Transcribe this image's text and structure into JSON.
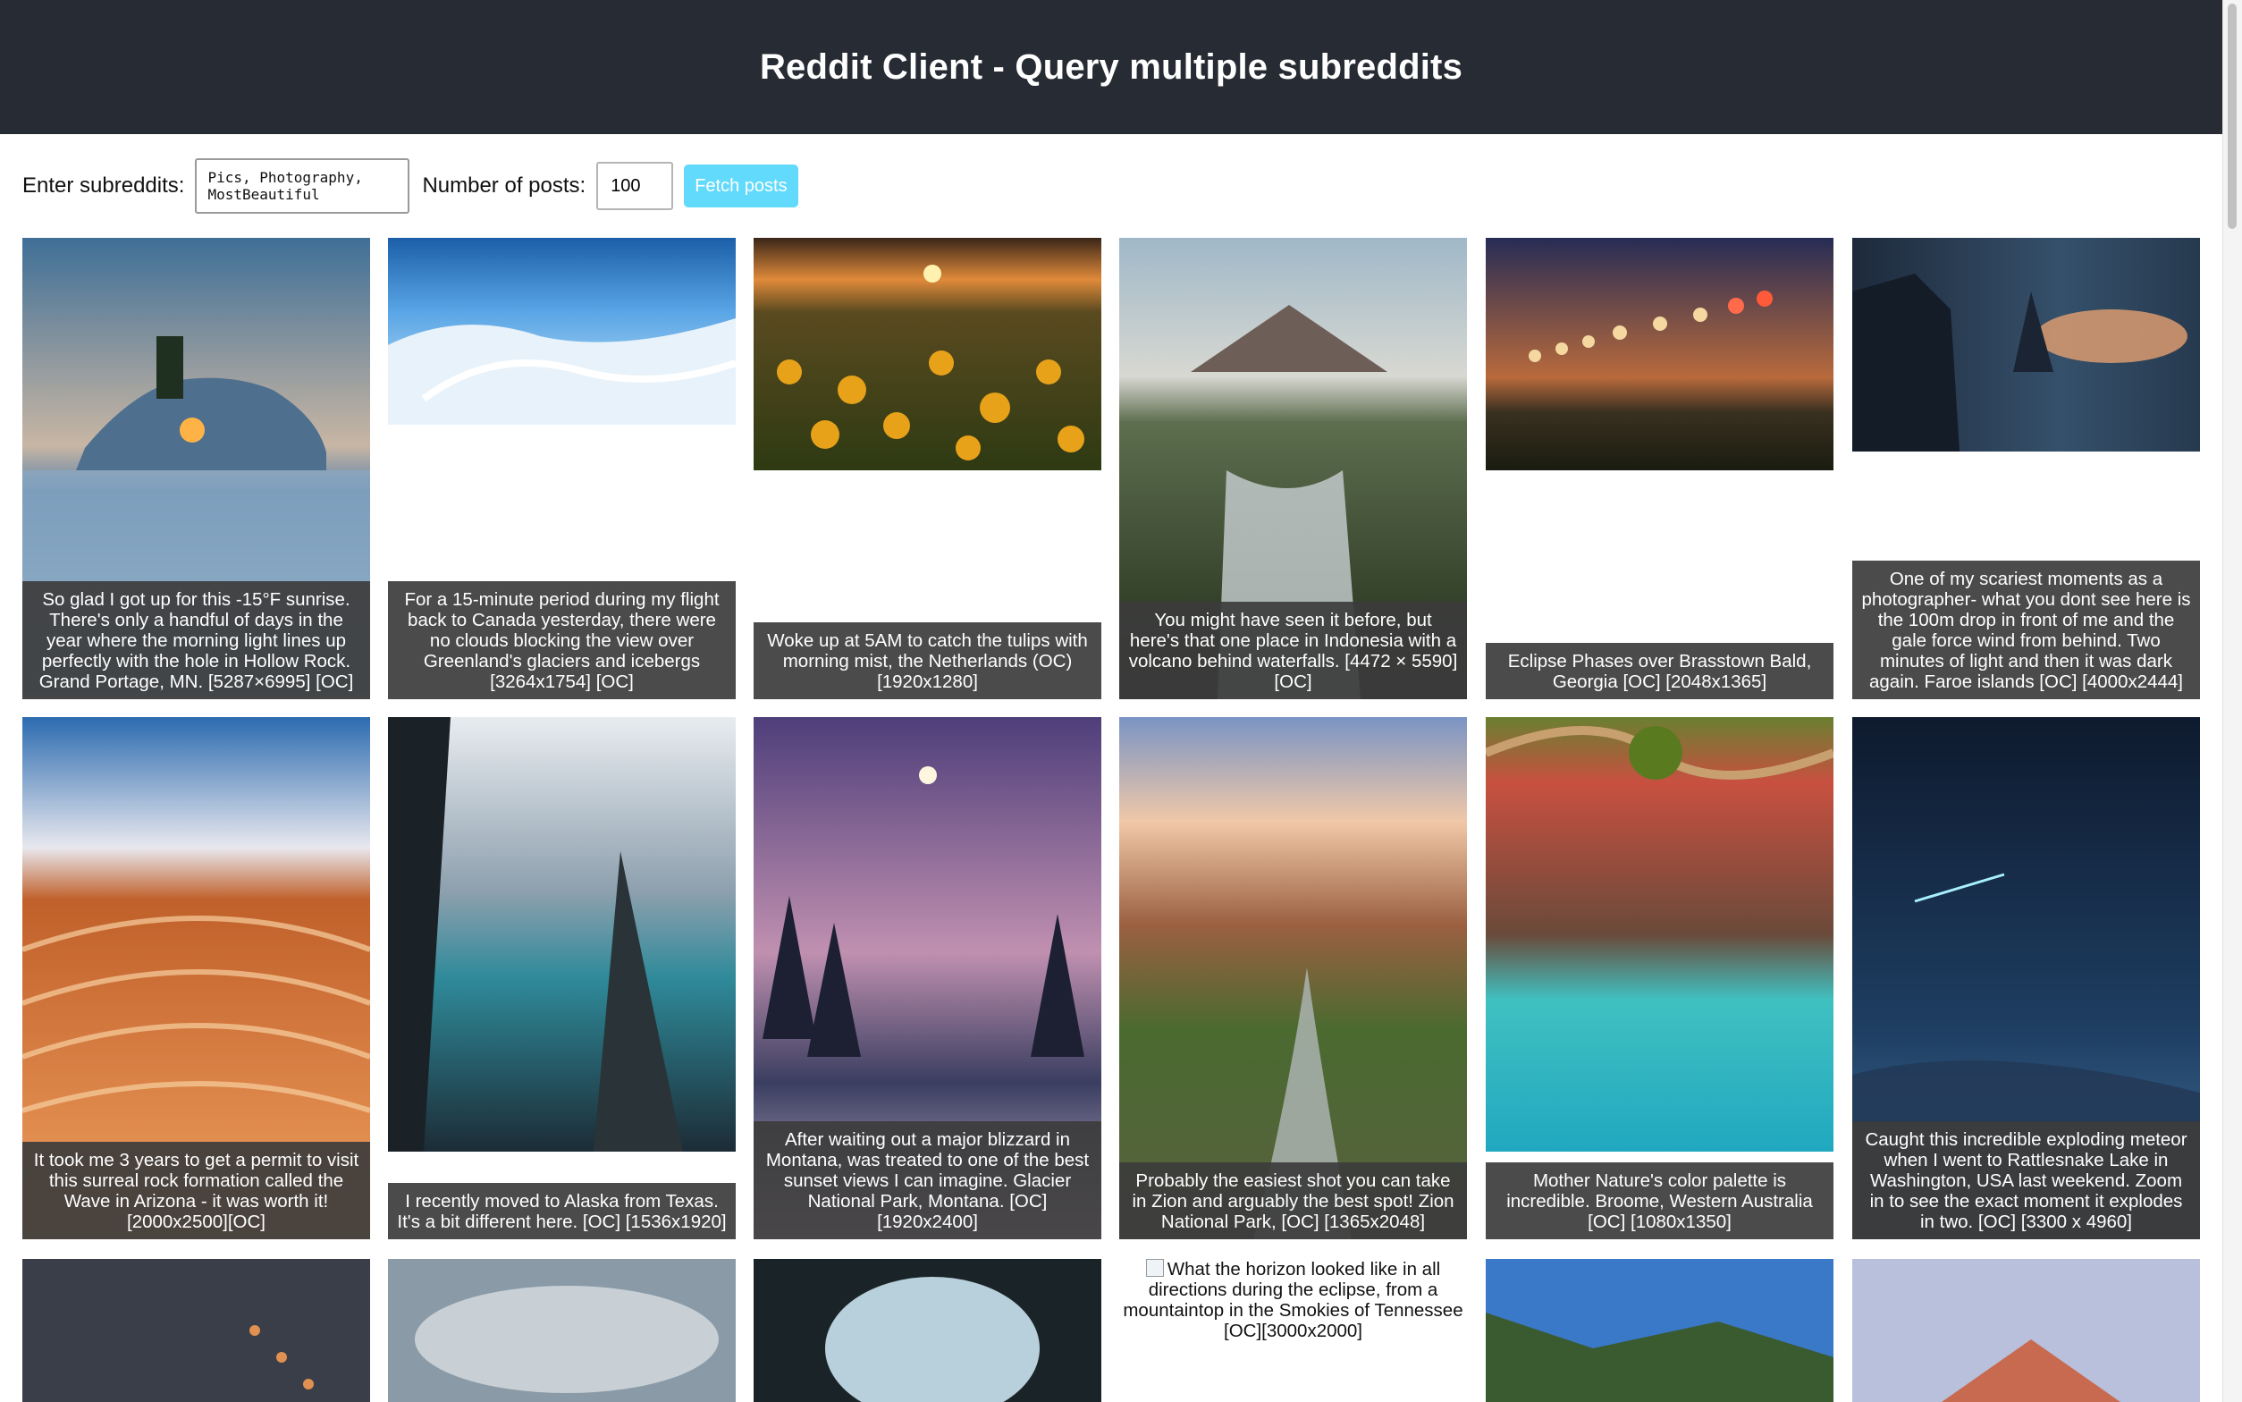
{
  "header": {
    "title": "Reddit Client - Query multiple subreddits"
  },
  "controls": {
    "subreddits_label": "Enter subreddits:",
    "subreddits_value": "Pics, Photography, MostBeautiful",
    "posts_label": "Number of posts:",
    "posts_value": "100",
    "fetch_label": "Fetch posts"
  },
  "posts": [
    {
      "caption": "So glad I got up for this -15°F sunrise. There's only a handful of days in the year where the morning light lines up perfectly with the hole in Hollow Rock. Grand Portage, MN. [5287×6995] [OC]"
    },
    {
      "caption": "For a 15-minute period during my flight back to Canada yesterday, there were no clouds blocking the view over Greenland's glaciers and icebergs [3264x1754] [OC]"
    },
    {
      "caption": "Woke up at 5AM to catch the tulips with morning mist, the Netherlands (OC) [1920x1280]"
    },
    {
      "caption": "You might have seen it before, but here's that one place in Indonesia with a volcano behind waterfalls. [4472 × 5590] [OC]"
    },
    {
      "caption": "Eclipse Phases over Brasstown Bald, Georgia [OC] [2048x1365]"
    },
    {
      "caption": "One of my scariest moments as a photographer- what you dont see here is the 100m drop in front of me and the gale force wind from behind. Two minutes of light and then it was dark again. Faroe islands [OC] [4000x2444]"
    },
    {
      "caption": "It took me 3 years to get a permit to visit this surreal rock formation called the Wave in Arizona - it was worth it! [2000x2500][OC]"
    },
    {
      "caption": "I recently moved to Alaska from Texas. It's a bit different here. [OC] [1536x1920]"
    },
    {
      "caption": "After waiting out a major blizzard in Montana, was treated to one of the best sunset views I can imagine. Glacier National Park, Montana. [OC] [1920x2400]"
    },
    {
      "caption": "Probably the easiest shot you can take in Zion and arguably the best spot! Zion National Park, [OC] [1365x2048]"
    },
    {
      "caption": "Mother Nature's color palette is incredible. Broome, Western Australia [OC] [1080x1350]"
    },
    {
      "caption": "Caught this incredible exploding meteor when I went to Rattlesnake Lake in Washington, USA last weekend. Zoom in to see the exact moment it explodes in two. [OC] [3300 x 4960]"
    }
  ],
  "broken_post": {
    "alt": "What the horizon looked like in all directions during the eclipse, from a mountaintop in the Smokies of Tennessee [OC][3000x2000]"
  }
}
